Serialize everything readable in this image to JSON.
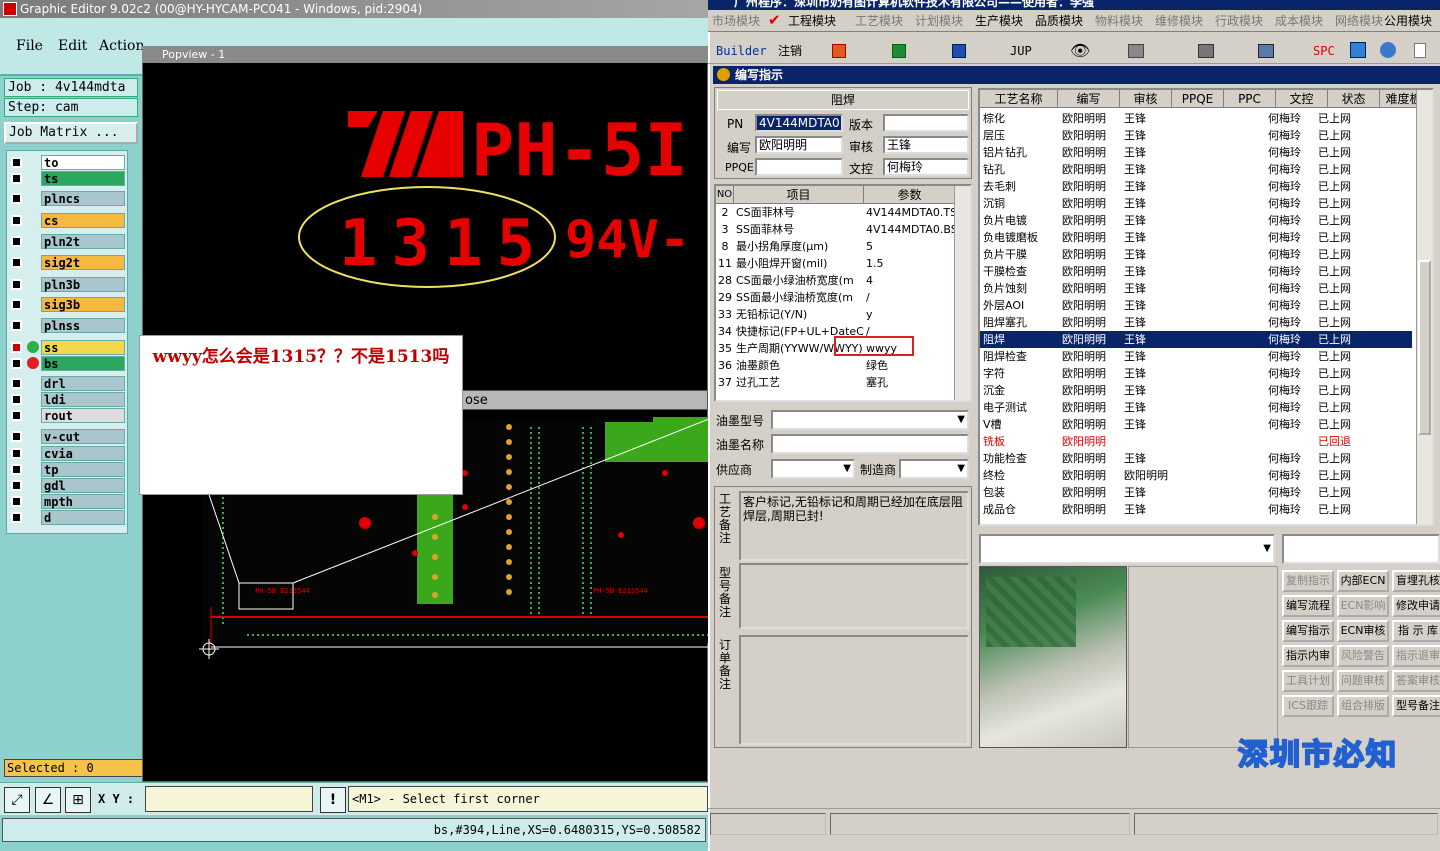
{
  "left_app": {
    "title": "Graphic Editor 9.02c2 (00@HY-HYCAM-PC041 - Windows, pid:2904)",
    "menu": [
      "File",
      "Edit",
      "Action"
    ],
    "job": "Job : 4v144mdta",
    "step": "Step: cam",
    "job_matrix": "Job Matrix ...",
    "layers": [
      {
        "name": "to",
        "color": "#ffffff"
      },
      {
        "name": "ts",
        "color": "#2aa860"
      },
      {
        "name": "plncs",
        "color": "#a9c6cc"
      },
      {
        "name": "cs",
        "color": "#f5b840"
      },
      {
        "name": "pln2t",
        "color": "#a9c6cc"
      },
      {
        "name": "sig2t",
        "color": "#f5b840"
      },
      {
        "name": "pln3b",
        "color": "#a9c6cc"
      },
      {
        "name": "sig3b",
        "color": "#f5b840"
      },
      {
        "name": "plnss",
        "color": "#a9c6cc"
      },
      {
        "name": "ss",
        "color": "#f5d84a"
      },
      {
        "name": "bs",
        "color": "#2aa860"
      },
      {
        "name": "drl",
        "color": "#a9c6cc"
      },
      {
        "name": "ldi",
        "color": "#a9c6cc"
      },
      {
        "name": "rout",
        "color": "#dddddd"
      },
      {
        "name": "v-cut",
        "color": "#a9c6cc"
      },
      {
        "name": "cvia",
        "color": "#a9c6cc"
      },
      {
        "name": "tp",
        "color": "#a9c6cc"
      },
      {
        "name": "gdl",
        "color": "#a9c6cc"
      },
      {
        "name": "mpth",
        "color": "#a9c6cc"
      },
      {
        "name": "d",
        "color": "#a9c6cc"
      }
    ],
    "selected": "Selected : 0",
    "popview_title": "Popview - 1",
    "subwin_title": "ose",
    "xy_label": "X Y :",
    "prompt": "<M1> - Select first corner",
    "status": "bs,#394,Line,XS=0.6480315,YS=0.508582",
    "pcb_text_top": "PH-5I",
    "pcb_text_code": "1315",
    "pcb_text_94": "94V-",
    "pcb_small_1": "PH-5B E213544",
    "pcb_small_2": "PH-5B E213544",
    "callout": "wwyy怎么会是1315？？不是1513吗"
  },
  "right_app": {
    "title": "广州程序：深圳市奶有图计算机软件技术有限公司——使用者：李强",
    "modules": [
      "市场模块",
      "工程模块",
      "工艺模块",
      "计划模块",
      "生产模块",
      "品质模块",
      "物料模块",
      "维修模块",
      "行政模块",
      "成本模块",
      "网络模块",
      "公用模块"
    ],
    "toolbar": {
      "builder": "Builder",
      "note": "注销",
      "jup": "JUP",
      "spc": "SPC"
    },
    "window_title": "编写指示",
    "section": "阻焊",
    "form": {
      "pn_label": "PN",
      "pn": "4V144MDTA0",
      "version_label": "版本",
      "version": "",
      "writer_label": "编写",
      "writer": "欧阳明明",
      "reviewer_label": "审核",
      "reviewer": "王锋",
      "ppqe_label": "PPQE",
      "ppqe": "",
      "doc_label": "文控",
      "doc": "何梅玲"
    },
    "params_headers": [
      "NO",
      "项目",
      "参数"
    ],
    "params": [
      {
        "no": "2",
        "item": "CS面菲林号",
        "value": "4V144MDTA0.TS"
      },
      {
        "no": "3",
        "item": "SS面菲林号",
        "value": "4V144MDTA0.BS"
      },
      {
        "no": "8",
        "item": "最小拐角厚度(μm)",
        "value": "5"
      },
      {
        "no": "11",
        "item": "最小阻焊开窗(mil)",
        "value": "1.5"
      },
      {
        "no": "28",
        "item": "CS面最小绿油桥宽度(m",
        "value": "4"
      },
      {
        "no": "29",
        "item": "SS面最小绿油桥宽度(m",
        "value": "/"
      },
      {
        "no": "33",
        "item": "无铅标记(Y/N)",
        "value": "y"
      },
      {
        "no": "34",
        "item": "快捷标记(FP+UL+DateCo",
        "value": "/"
      },
      {
        "no": "35",
        "item": "生产周期(YYWW/WWYY)",
        "value": "wwyy"
      },
      {
        "no": "36",
        "item": "油墨颜色",
        "value": "绿色"
      },
      {
        "no": "37",
        "item": "过孔工艺",
        "value": "塞孔"
      }
    ],
    "ink_model_label": "油墨型号",
    "ink_name_label": "油墨名称",
    "supplier_label": "供应商",
    "maker_label": "制造商",
    "process_note_label": "工艺备注",
    "process_note": "客户标记,无铅标记和周期已经加在底层阻焊层,周期已封!",
    "model_note_label": "型号备注",
    "order_note_label": "订单备注",
    "process_headers": [
      "工艺名称",
      "编写",
      "审核",
      "PPQE",
      "PPC",
      "文控",
      "状态",
      "难度板"
    ],
    "processes": [
      {
        "name": "棕化",
        "writer": "欧阳明明",
        "reviewer": "王锋",
        "ppqe": "",
        "ppc": "",
        "doc": "何梅玲",
        "status": "已上网",
        "red": false,
        "sel": false
      },
      {
        "name": "层压",
        "writer": "欧阳明明",
        "reviewer": "王锋",
        "ppqe": "",
        "ppc": "",
        "doc": "何梅玲",
        "status": "已上网",
        "red": false,
        "sel": false
      },
      {
        "name": "铝片钻孔",
        "writer": "欧阳明明",
        "reviewer": "王锋",
        "ppqe": "",
        "ppc": "",
        "doc": "何梅玲",
        "status": "已上网",
        "red": false,
        "sel": false
      },
      {
        "name": "钻孔",
        "writer": "欧阳明明",
        "reviewer": "王锋",
        "ppqe": "",
        "ppc": "",
        "doc": "何梅玲",
        "status": "已上网",
        "red": false,
        "sel": false
      },
      {
        "name": "去毛刺",
        "writer": "欧阳明明",
        "reviewer": "王锋",
        "ppqe": "",
        "ppc": "",
        "doc": "何梅玲",
        "status": "已上网",
        "red": false,
        "sel": false
      },
      {
        "name": "沉铜",
        "writer": "欧阳明明",
        "reviewer": "王锋",
        "ppqe": "",
        "ppc": "",
        "doc": "何梅玲",
        "status": "已上网",
        "red": false,
        "sel": false
      },
      {
        "name": "负片电镀",
        "writer": "欧阳明明",
        "reviewer": "王锋",
        "ppqe": "",
        "ppc": "",
        "doc": "何梅玲",
        "status": "已上网",
        "red": false,
        "sel": false
      },
      {
        "name": "负电镀磨板",
        "writer": "欧阳明明",
        "reviewer": "王锋",
        "ppqe": "",
        "ppc": "",
        "doc": "何梅玲",
        "status": "已上网",
        "red": false,
        "sel": false
      },
      {
        "name": "负片干膜",
        "writer": "欧阳明明",
        "reviewer": "王锋",
        "ppqe": "",
        "ppc": "",
        "doc": "何梅玲",
        "status": "已上网",
        "red": false,
        "sel": false
      },
      {
        "name": "干膜检查",
        "writer": "欧阳明明",
        "reviewer": "王锋",
        "ppqe": "",
        "ppc": "",
        "doc": "何梅玲",
        "status": "已上网",
        "red": false,
        "sel": false
      },
      {
        "name": "负片蚀刻",
        "writer": "欧阳明明",
        "reviewer": "王锋",
        "ppqe": "",
        "ppc": "",
        "doc": "何梅玲",
        "status": "已上网",
        "red": false,
        "sel": false
      },
      {
        "name": "外层AOI",
        "writer": "欧阳明明",
        "reviewer": "王锋",
        "ppqe": "",
        "ppc": "",
        "doc": "何梅玲",
        "status": "已上网",
        "red": false,
        "sel": false
      },
      {
        "name": "阻焊塞孔",
        "writer": "欧阳明明",
        "reviewer": "王锋",
        "ppqe": "",
        "ppc": "",
        "doc": "何梅玲",
        "status": "已上网",
        "red": false,
        "sel": false
      },
      {
        "name": "阻焊",
        "writer": "欧阳明明",
        "reviewer": "王锋",
        "ppqe": "",
        "ppc": "",
        "doc": "何梅玲",
        "status": "已上网",
        "red": false,
        "sel": true
      },
      {
        "name": "阻焊检查",
        "writer": "欧阳明明",
        "reviewer": "王锋",
        "ppqe": "",
        "ppc": "",
        "doc": "何梅玲",
        "status": "已上网",
        "red": false,
        "sel": false
      },
      {
        "name": "字符",
        "writer": "欧阳明明",
        "reviewer": "王锋",
        "ppqe": "",
        "ppc": "",
        "doc": "何梅玲",
        "status": "已上网",
        "red": false,
        "sel": false
      },
      {
        "name": "沉金",
        "writer": "欧阳明明",
        "reviewer": "王锋",
        "ppqe": "",
        "ppc": "",
        "doc": "何梅玲",
        "status": "已上网",
        "red": false,
        "sel": false
      },
      {
        "name": "电子测试",
        "writer": "欧阳明明",
        "reviewer": "王锋",
        "ppqe": "",
        "ppc": "",
        "doc": "何梅玲",
        "status": "已上网",
        "red": false,
        "sel": false
      },
      {
        "name": "V槽",
        "writer": "欧阳明明",
        "reviewer": "王锋",
        "ppqe": "",
        "ppc": "",
        "doc": "何梅玲",
        "status": "已上网",
        "red": false,
        "sel": false
      },
      {
        "name": "铣板",
        "writer": "欧阳明明",
        "reviewer": "",
        "ppqe": "",
        "ppc": "",
        "doc": "",
        "status": "已回退",
        "red": true,
        "sel": false
      },
      {
        "name": "功能检查",
        "writer": "欧阳明明",
        "reviewer": "王锋",
        "ppqe": "",
        "ppc": "",
        "doc": "何梅玲",
        "status": "已上网",
        "red": false,
        "sel": false
      },
      {
        "name": "终检",
        "writer": "欧阳明明",
        "reviewer": "欧阳明明",
        "ppqe": "",
        "ppc": "",
        "doc": "何梅玲",
        "status": "已上网",
        "red": false,
        "sel": false
      },
      {
        "name": "包装",
        "writer": "欧阳明明",
        "reviewer": "王锋",
        "ppqe": "",
        "ppc": "",
        "doc": "何梅玲",
        "status": "已上网",
        "red": false,
        "sel": false
      },
      {
        "name": "成品仓",
        "writer": "欧阳明明",
        "reviewer": "王锋",
        "ppqe": "",
        "ppc": "",
        "doc": "何梅玲",
        "status": "已上网",
        "red": false,
        "sel": false
      }
    ],
    "side_buttons": [
      {
        "label": "复制指示",
        "enabled": false
      },
      {
        "label": "内部ECN",
        "enabled": true
      },
      {
        "label": "盲埋孔核",
        "enabled": true
      },
      {
        "label": "编写流程",
        "enabled": true
      },
      {
        "label": "ECN影响",
        "enabled": false
      },
      {
        "label": "修改申请",
        "enabled": true
      },
      {
        "label": "编写指示",
        "enabled": true
      },
      {
        "label": "ECN审核",
        "enabled": true
      },
      {
        "label": "指 示 库",
        "enabled": true
      },
      {
        "label": "指示内审",
        "enabled": true
      },
      {
        "label": "风险警告",
        "enabled": false
      },
      {
        "label": "指示退审",
        "enabled": false
      },
      {
        "label": "工具计划",
        "enabled": false
      },
      {
        "label": "问题审核",
        "enabled": false
      },
      {
        "label": "答案审核",
        "enabled": false
      },
      {
        "label": "ICS跟踪",
        "enabled": false
      },
      {
        "label": "组合排版",
        "enabled": false
      },
      {
        "label": "型号备注",
        "enabled": true
      }
    ],
    "banner": "深圳市必知"
  }
}
